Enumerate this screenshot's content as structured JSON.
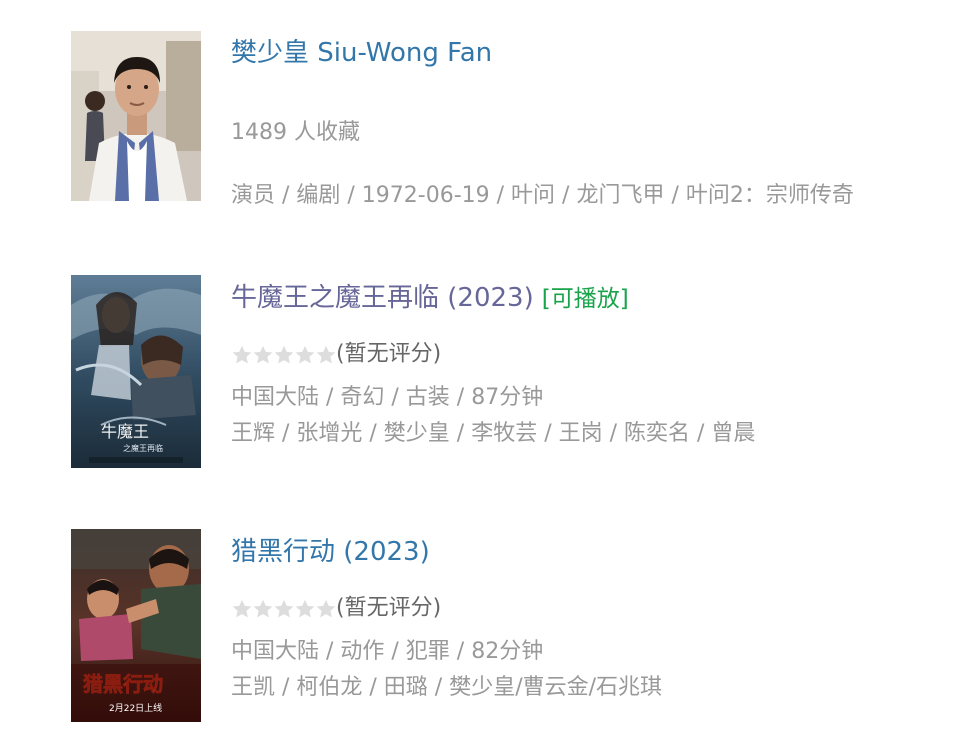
{
  "colors": {
    "link": "#3377aa",
    "visited_link": "#666699",
    "playable": "#1aa34a",
    "meta": "#999999",
    "star_empty": "#dddddd"
  },
  "results": [
    {
      "kind": "person",
      "image_icon": "portrait-photo",
      "title": "樊少皇 Siu-Wong Fan",
      "collections": "1489 人收藏",
      "details": "演员 / 编剧 / 1972-06-19 / 叶问 / 龙门飞甲 / 叶问2：宗师传奇"
    },
    {
      "kind": "movie",
      "image_icon": "movie-poster",
      "title": "牛魔王之魔王再临 (2023)",
      "playable_badge": "[可播放]",
      "stars_filled": 0,
      "stars_total": 5,
      "rating_text": "(暂无评分)",
      "meta": "中国大陆 / 奇幻 / 古装 / 87分钟",
      "cast": "王辉 / 张增光 / 樊少皇 / 李牧芸 / 王岗 / 陈奕名 / 曾晨"
    },
    {
      "kind": "movie",
      "image_icon": "movie-poster",
      "title": "猎黑行动 (2023)",
      "stars_filled": 0,
      "stars_total": 5,
      "rating_text": "(暂无评分)",
      "meta": "中国大陆 / 动作 / 犯罪 / 82分钟",
      "cast": "王凯 / 柯伯龙 / 田璐 / 樊少皇/曹云金/石兆琪"
    }
  ]
}
